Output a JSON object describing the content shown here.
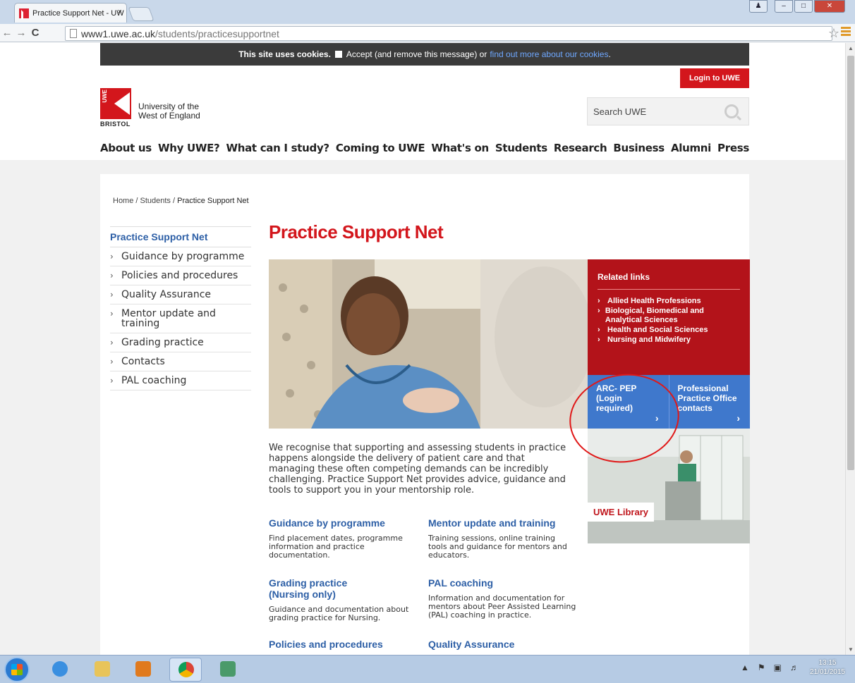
{
  "browser": {
    "tab_title": "Practice Support Net - UW",
    "tab_close": "×",
    "url_host": "www1.uwe.ac.uk",
    "url_path": "/students/practicesupportnet",
    "star": "☆"
  },
  "cookie_bar": {
    "bold_text": "This site uses cookies.",
    "accept_text": "Accept (and remove this message) or",
    "link_text": "find out more about our cookies",
    "end": "."
  },
  "header": {
    "login_label": "Login to UWE",
    "logo_letters": "UWE",
    "logo_bristol": "BRISTOL",
    "logo_name_line1": "University of the",
    "logo_name_line2": "West of England",
    "search_placeholder": "Search UWE"
  },
  "main_nav": [
    "About us",
    "Why UWE?",
    "What can I study?",
    "Coming to UWE",
    "What's on",
    "Students",
    "Research",
    "Business",
    "Alumni",
    "Press"
  ],
  "breadcrumb": {
    "home": "Home",
    "sep": " / ",
    "students": "Students",
    "current": "Practice Support Net"
  },
  "sidebar": {
    "title": "Practice Support Net",
    "chev": "›",
    "items": [
      "Guidance by programme",
      "Policies and procedures",
      "Quality Assurance",
      "Mentor update and training",
      "Grading practice",
      "Contacts",
      "PAL coaching"
    ]
  },
  "page_title": "Practice Support Net",
  "related": {
    "title": "Related links",
    "chev": "›",
    "links": [
      "Allied Health Professions",
      "Biological, Biomedical and Analytical Sciences",
      "Health and Social Sciences",
      "Nursing and Midwifery"
    ]
  },
  "tiles": {
    "arc": "ARC- PEP (Login required)",
    "ppo": "Professional Practice Office contacts",
    "arrow": "›"
  },
  "library_label": "UWE Library",
  "intro": "We recognise that supporting and assessing students in practice happens alongside the delivery of patient care and that managing these often competing demands can be incredibly challenging. Practice Support Net provides advice, guidance and tools to support you in your mentorship role.",
  "blocks": [
    {
      "title": "Guidance by programme",
      "text": "Find placement dates, programme information and practice documentation."
    },
    {
      "title": "Mentor update and training",
      "text": "Training sessions, online training tools and guidance for mentors and educators."
    },
    {
      "title": "Grading practice (Nursing only)",
      "text": "Guidance and documentation about grading practice for Nursing."
    },
    {
      "title": "PAL coaching",
      "text": "Information and documentation for mentors about Peer Assisted Learning (PAL) coaching in practice."
    },
    {
      "title": "Policies and procedures",
      "text": ""
    },
    {
      "title": "Quality Assurance",
      "text": ""
    }
  ],
  "taskbar": {
    "time": "13:15",
    "date": "21/01/2015"
  },
  "colors": {
    "uwe_red": "#d3161c",
    "link_blue": "#2d5fa6",
    "tile_blue": "#3f78cc",
    "related_red": "#b3131a"
  }
}
